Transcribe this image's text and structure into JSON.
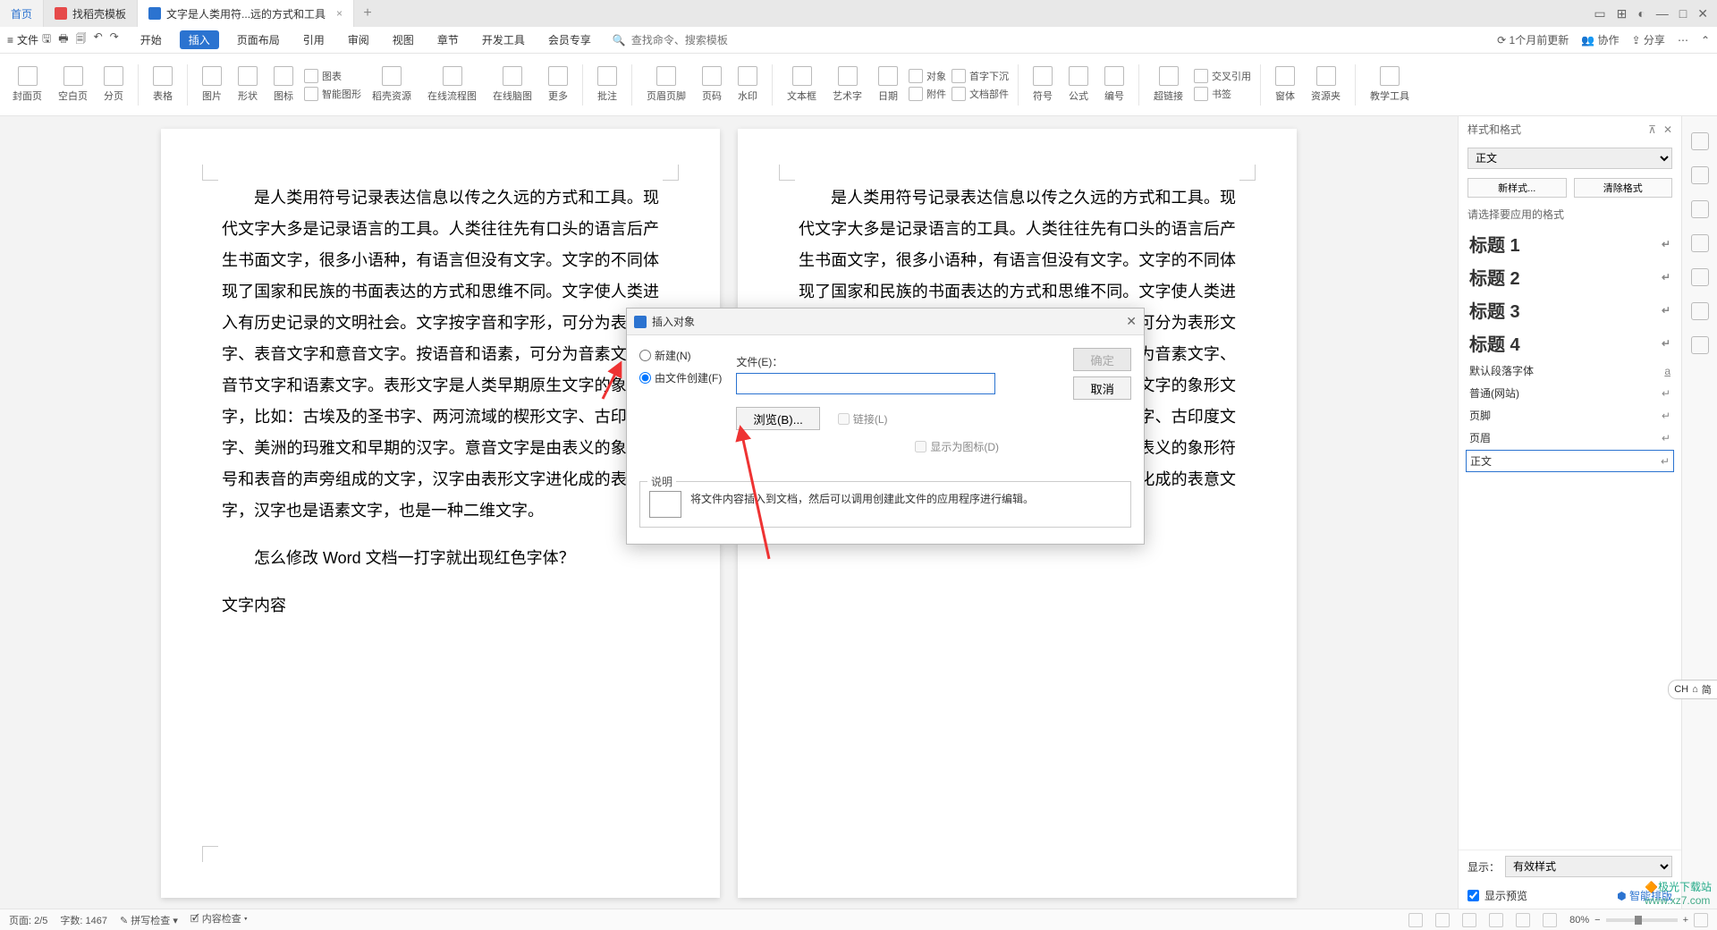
{
  "tabs": {
    "home": "首页",
    "t1": "找稻壳模板",
    "t2": "文字是人类用符...远的方式和工具"
  },
  "menu": {
    "file": "文件",
    "items": [
      "开始",
      "插入",
      "页面布局",
      "引用",
      "审阅",
      "视图",
      "章节",
      "开发工具",
      "会员专享"
    ],
    "search_icon": "🔍",
    "search_ph": "查找命令、搜索模板",
    "update": "1个月前更新",
    "coop": "协作",
    "share": "分享"
  },
  "ribbon": {
    "groups": [
      "封面页",
      "空白页",
      "分页",
      "表格",
      "图片",
      "形状",
      "图标",
      "智能图形",
      "稻壳资源",
      "在线流程图",
      "在线脑图",
      "更多",
      "批注",
      "页眉页脚",
      "页码",
      "水印",
      "文本框",
      "艺术字",
      "日期",
      "附件",
      "文档部件",
      "符号",
      "公式",
      "编号",
      "超链接",
      "书签",
      "窗体",
      "资源夹",
      "教学工具"
    ],
    "side": {
      "a": "对象",
      "b": "首字下沉",
      "c": "交叉引用"
    }
  },
  "doc": {
    "p1": "是人类用符号记录表达信息以传之久远的方式和工具。现代文字大多是记录语言的工具。人类往往先有口头的语言后产生书面文字，很多小语种，有语言但没有文字。文字的不同体现了国家和民族的书面表达的方式和思维不同。文字使人类进入有历史记录的文明社会。文字按字音和字形，可分为表形文字、表音文字和意音文字。按语音和语素，可分为音素文字、音节文字和语素文字。表形文字是人类早期原生文字的象形文字，比如：古埃及的圣书字、两河流域的楔形文字、古印度文字、美洲的玛雅文和早期的汉字。意音文字是由表义的象形符号和表音的声旁组成的文字，汉字由表形文字进化成的表意文字，汉字也是语素文字，也是一种二维文字。",
    "p2": "是人类用符号记录表达信息以传之久远的方式和工具。现代文字大多是记录语言的工具。人类往往先有口头的语言后产生书面文字，很多小语种，有语言但没有文字。文字的不同体现了国家和民族的书面表达的方式和思维不同。文字使人类进入有历史记录的文明社会。文字按字音和字形，可分为表形文字、表音文字和意音文字。按语音和语素，可分为音素文字、音节文字和语素文字。表形文字是人类早期原生文字的象形文字，比如：古埃及的圣书字、两河流域的楔形文字、古印度文字、美洲的玛雅文和早期的汉字。意音文字是由表义的象形符号和表音的声旁组成的文字，汉字由表形文字进化成的表意文字，汉字也是语素文字，也是一种二维文字。",
    "q": "怎么修改 Word 文档一打字就出现红色字体？",
    "c": "文字内容"
  },
  "dialog": {
    "title": "插入对象",
    "new": "新建(N)",
    "fromfile": "由文件创建(F)",
    "filelabel": "文件(E)：",
    "browse": "浏览(B)...",
    "link": "链接(L)",
    "asicon": "显示为图标(D)",
    "ok": "确定",
    "cancel": "取消",
    "desc_title": "说明",
    "desc": "将文件内容插入到文档，然后可以调用创建此文件的应用程序进行编辑。"
  },
  "panel": {
    "title": "样式和格式",
    "current": "正文",
    "newstyle": "新样式...",
    "clear": "清除格式",
    "choose": "请选择要应用的格式",
    "styles": [
      "标题 1",
      "标题 2",
      "标题 3",
      "标题 4",
      "默认段落字体",
      "普通(网站)",
      "页脚",
      "页眉",
      "正文"
    ],
    "show": "显示：",
    "showopt": "有效样式",
    "preview": "显示预览",
    "ai": "智能排版"
  },
  "ime": {
    "a": "CH",
    "b": "简"
  },
  "status": {
    "page": "页面: 2/5",
    "words": "字数: 1467",
    "spell": "拼写检查",
    "content": "内容检查",
    "zoom": "80%"
  },
  "watermark": {
    "a": "极光下载站",
    "b": "www.xz7.com"
  }
}
